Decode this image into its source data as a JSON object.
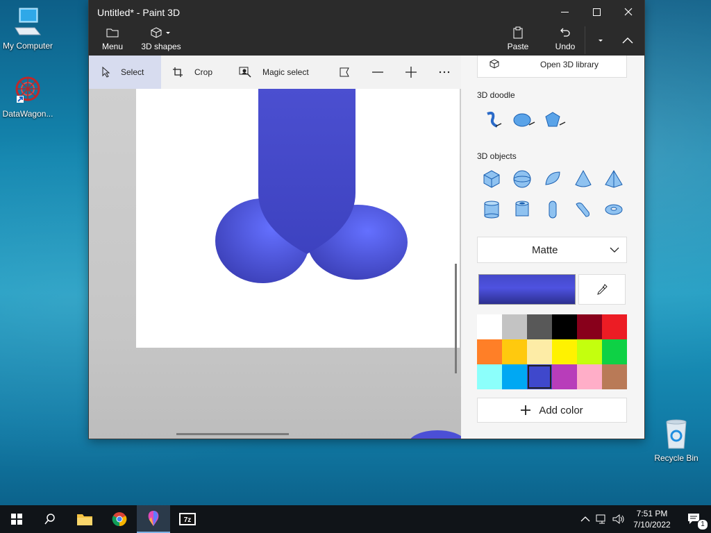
{
  "desktop": {
    "icons": [
      {
        "label": "My Computer"
      },
      {
        "label": "DataWagon..."
      },
      {
        "label": "Recycle Bin"
      }
    ]
  },
  "window": {
    "title": "Untitled* - Paint 3D",
    "ribbon": {
      "menu_label": "Menu",
      "shapes_label": "3D shapes",
      "paste_label": "Paste",
      "undo_label": "Undo"
    },
    "toolbar": {
      "select": "Select",
      "crop": "Crop",
      "magic_select": "Magic select"
    }
  },
  "panel": {
    "open_library": "Open 3D library",
    "doodle_title": "3D doodle",
    "objects_title": "3D objects",
    "material": "Matte",
    "add_color": "Add color",
    "current_color": "#4449c9",
    "swatches": [
      "#ffffff",
      "#c3c3c3",
      "#585858",
      "#000000",
      "#88001b",
      "#ec1c24",
      "#ff7f27",
      "#ffc90e",
      "#fdeca6",
      "#fff200",
      "#c4ff0e",
      "#0ed145",
      "#8cfffb",
      "#00a8f3",
      "#3f48cc",
      "#b83dba",
      "#ffaec8",
      "#b97a57"
    ],
    "selected_swatch": 14
  },
  "taskbar": {
    "time": "7:51 PM",
    "date": "7/10/2022",
    "notification_count": "1"
  }
}
